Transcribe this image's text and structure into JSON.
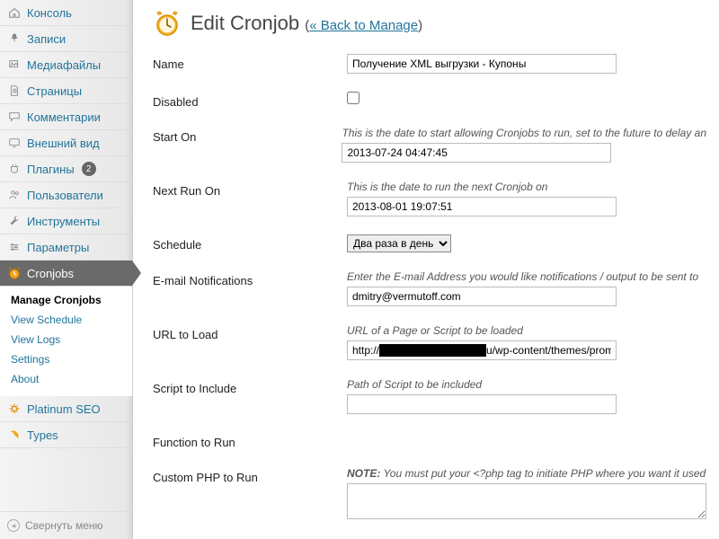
{
  "sidebar": {
    "items": [
      {
        "label": "Консоль",
        "icon": "home"
      },
      {
        "label": "Записи",
        "icon": "pin"
      },
      {
        "label": "Медиафайлы",
        "icon": "media"
      },
      {
        "label": "Страницы",
        "icon": "page"
      },
      {
        "label": "Комментарии",
        "icon": "comment"
      },
      {
        "label": "Внешний вид",
        "icon": "appearance"
      },
      {
        "label": "Плагины",
        "icon": "plug",
        "badge": "2"
      },
      {
        "label": "Пользователи",
        "icon": "users"
      },
      {
        "label": "Инструменты",
        "icon": "tools"
      },
      {
        "label": "Параметры",
        "icon": "settings"
      },
      {
        "label": "Cronjobs",
        "icon": "clock",
        "current": true
      },
      {
        "label": "Platinum SEO",
        "icon": "gear-orange"
      },
      {
        "label": "Types",
        "icon": "types"
      }
    ],
    "cronjobs_submenu": [
      {
        "label": "Manage Cronjobs",
        "strong": true
      },
      {
        "label": "View Schedule"
      },
      {
        "label": "View Logs"
      },
      {
        "label": "Settings"
      },
      {
        "label": "About"
      }
    ],
    "collapse_label": "Свернуть меню"
  },
  "page": {
    "title": "Edit Cronjob",
    "back_open": "(",
    "back_link": "« Back to Manage",
    "back_close": ")"
  },
  "form": {
    "name": {
      "label": "Name",
      "value": "Получение XML выгрузки - Купоны"
    },
    "disabled": {
      "label": "Disabled"
    },
    "start_on": {
      "label": "Start On",
      "hint": "This is the date to start allowing Cronjobs to run, set to the future to delay an",
      "value": "2013-07-24 04:47:45"
    },
    "next_run": {
      "label": "Next Run On",
      "hint": "This is the date to run the next Cronjob on",
      "value": "2013-08-01 19:07:51"
    },
    "schedule": {
      "label": "Schedule",
      "value": "Два раза в день"
    },
    "email": {
      "label": "E-mail Notifications",
      "hint": "Enter the E-mail Address you would like notifications / output to be sent to",
      "value": "dmitry@vermutoff.com"
    },
    "url": {
      "label": "URL to Load",
      "hint": "URL of a Page or Script to be loaded",
      "value": "http://██████████████u/wp-content/themes/promoco"
    },
    "script": {
      "label": "Script to Include",
      "hint": "Path of Script to be included",
      "value": ""
    },
    "function": {
      "label": "Function to Run"
    },
    "php": {
      "label": "Custom PHP to Run",
      "hint_prefix": "NOTE:",
      "hint_rest": " You must put your <?php tag to initiate PHP where you want it used"
    }
  }
}
